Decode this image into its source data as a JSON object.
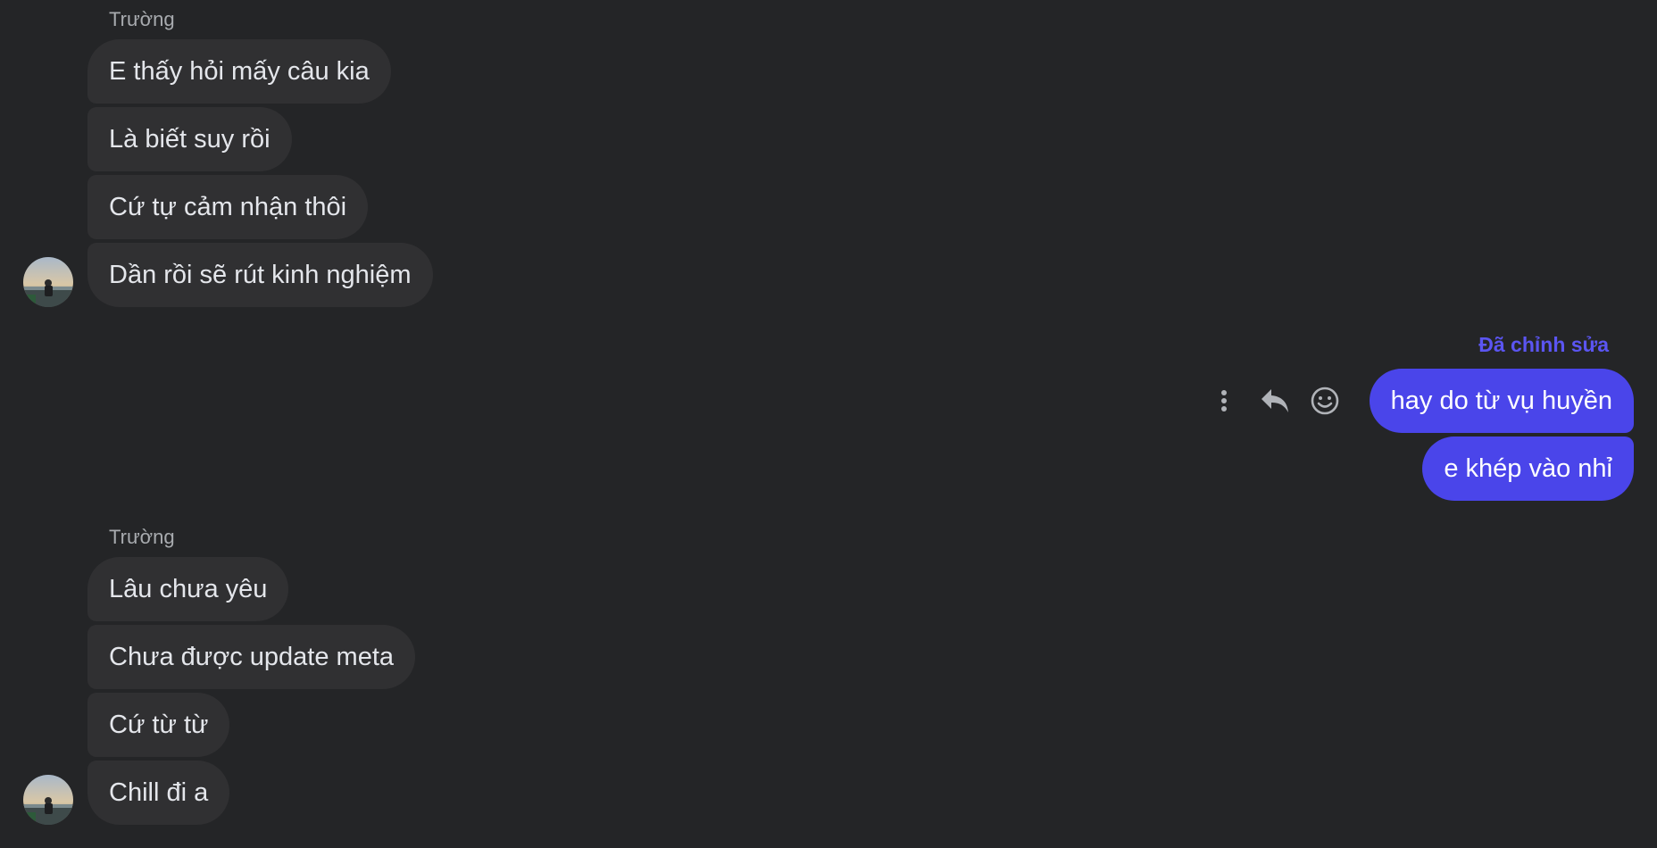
{
  "colors": {
    "background": "#242527",
    "incoming_bubble": "#303032",
    "outgoing_bubble": "#4a45ea",
    "edited_label": "#5b55f2",
    "sender_name": "#a8abaf"
  },
  "groups": [
    {
      "sender": "Trường",
      "messages": [
        "E thấy hỏi mấy câu kia",
        "Là biết suy rồi",
        "Cứ tự cảm nhận thôi",
        "Dần rồi sẽ rút kinh nghiệm"
      ]
    },
    {
      "sender": "Trường",
      "messages": [
        "Lâu chưa yêu",
        "Chưa được update meta",
        "Cứ từ từ",
        "Chill đi a"
      ]
    }
  ],
  "outgoing": {
    "edited_label": "Đã chỉnh sửa",
    "messages": [
      "hay do từ vụ huyền",
      "e khép vào nhỉ"
    ]
  },
  "actions": {
    "more_icon": "more-vertical-icon",
    "reply_icon": "reply-icon",
    "react_icon": "smiley-icon"
  }
}
